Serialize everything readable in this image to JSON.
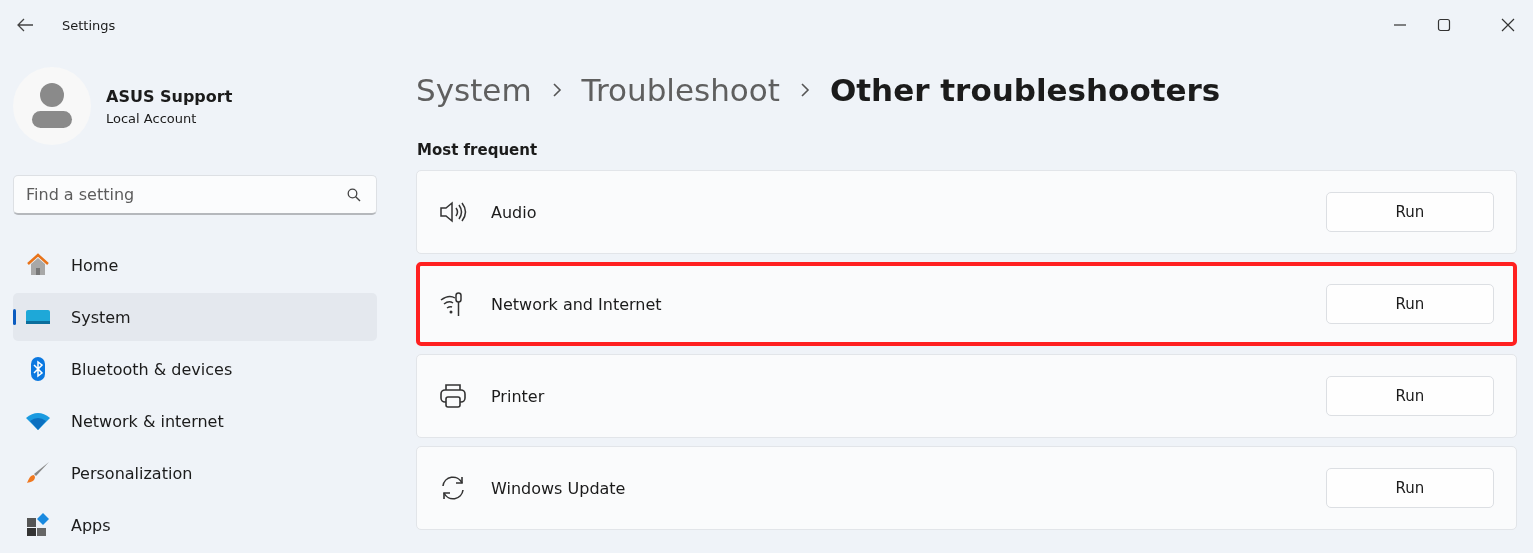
{
  "window": {
    "title": "Settings"
  },
  "account": {
    "name": "ASUS Support",
    "type": "Local Account"
  },
  "search": {
    "placeholder": "Find a setting"
  },
  "sidebar": {
    "items": [
      {
        "label": "Home",
        "kind": "home",
        "selected": false
      },
      {
        "label": "System",
        "kind": "system",
        "selected": true
      },
      {
        "label": "Bluetooth & devices",
        "kind": "bluetooth",
        "selected": false
      },
      {
        "label": "Network & internet",
        "kind": "network",
        "selected": false
      },
      {
        "label": "Personalization",
        "kind": "brush",
        "selected": false
      },
      {
        "label": "Apps",
        "kind": "apps",
        "selected": false
      }
    ]
  },
  "breadcrumb": [
    {
      "label": "System",
      "current": false
    },
    {
      "label": "Troubleshoot",
      "current": false
    },
    {
      "label": "Other troubleshooters",
      "current": true
    }
  ],
  "section": {
    "title": "Most frequent"
  },
  "troubleshooters": [
    {
      "label": "Audio",
      "kind": "audio",
      "button": "Run",
      "highlighted": false
    },
    {
      "label": "Network and Internet",
      "kind": "network",
      "button": "Run",
      "highlighted": true
    },
    {
      "label": "Printer",
      "kind": "printer",
      "button": "Run",
      "highlighted": false
    },
    {
      "label": "Windows Update",
      "kind": "update",
      "button": "Run",
      "highlighted": false
    }
  ]
}
